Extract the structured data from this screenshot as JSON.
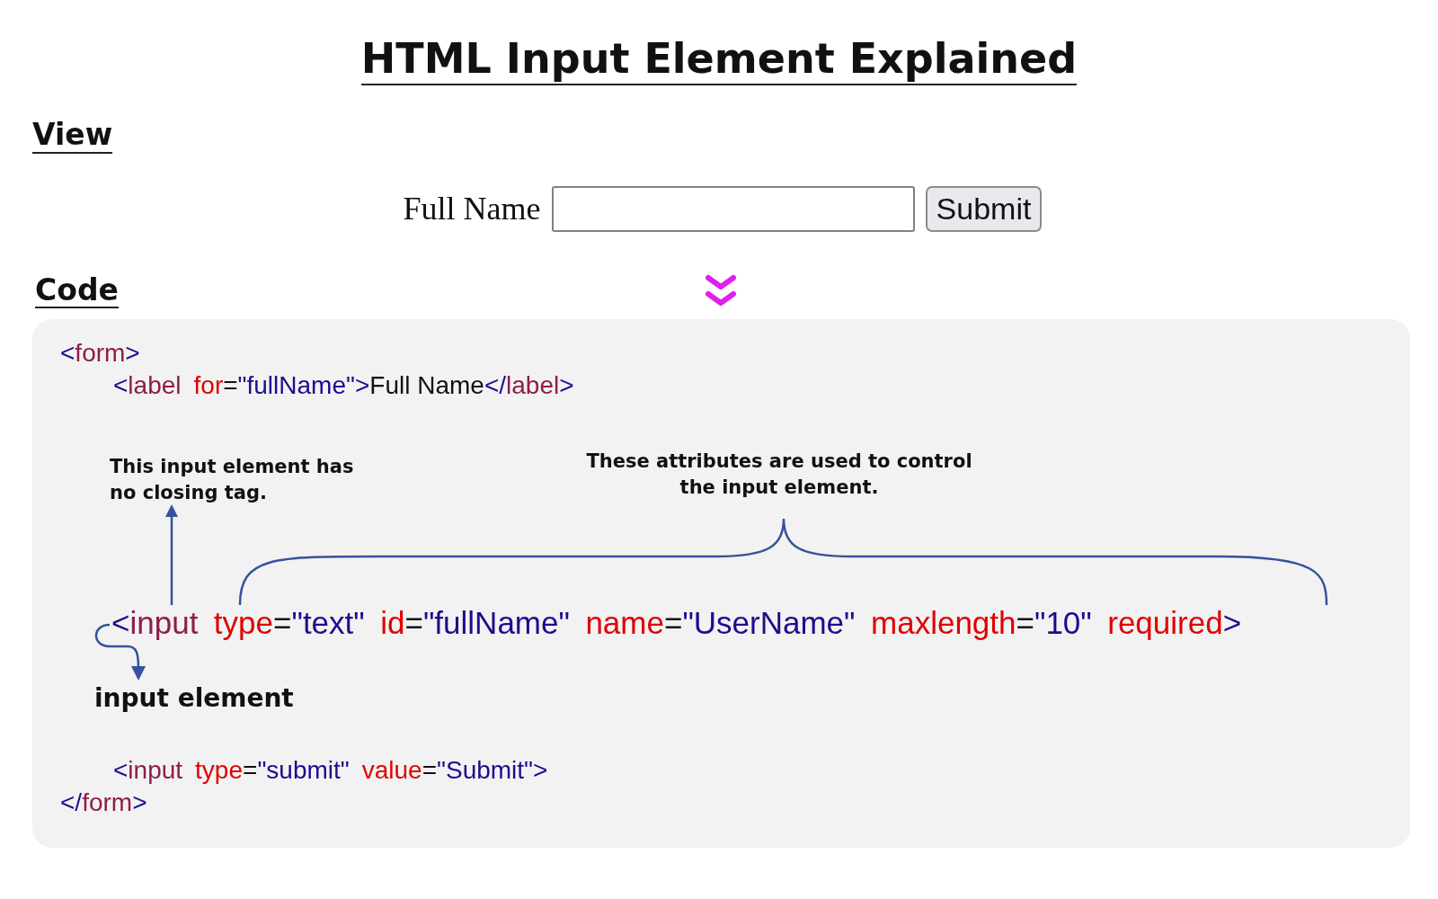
{
  "title": "HTML Input Element Explained",
  "view": {
    "heading": "View",
    "form": {
      "label": "Full Name",
      "button": "Submit"
    }
  },
  "code": {
    "heading": "Code",
    "open_tag": {
      "tokens": [
        {
          "kind": "punct",
          "text": "<"
        },
        {
          "kind": "tag",
          "text": "form"
        },
        {
          "kind": "punct",
          "text": ">"
        }
      ]
    },
    "children": [
      {
        "kind": "plain",
        "tokens": [
          {
            "kind": "punct",
            "text": "<"
          },
          {
            "kind": "tag",
            "text": "label"
          },
          {
            "kind": "attr",
            "text": "for"
          },
          {
            "kind": "eq",
            "text": "="
          },
          {
            "kind": "value",
            "text": "\"fullName\""
          },
          {
            "kind": "punct",
            "text": ">"
          },
          {
            "kind": "text",
            "text": "Full Name"
          },
          {
            "kind": "punct",
            "text": "</"
          },
          {
            "kind": "tag",
            "text": "label"
          },
          {
            "kind": "punct",
            "text": ">"
          }
        ]
      },
      {
        "kind": "annotated",
        "notes": {
          "closing": "This input element has\nno closing tag.",
          "attributes": "These attributes are used to control\nthe input element.",
          "element": "input element"
        },
        "tokens": [
          {
            "kind": "punct",
            "text": "<"
          },
          {
            "kind": "tag",
            "text": "input"
          },
          {
            "kind": "attr",
            "text": "type"
          },
          {
            "kind": "eq",
            "text": "="
          },
          {
            "kind": "value",
            "text": "\"text\""
          },
          {
            "kind": "attr",
            "text": "id"
          },
          {
            "kind": "eq",
            "text": "="
          },
          {
            "kind": "value",
            "text": "\"fullName\""
          },
          {
            "kind": "attr",
            "text": "name"
          },
          {
            "kind": "eq",
            "text": "="
          },
          {
            "kind": "value",
            "text": "\"UserName\""
          },
          {
            "kind": "attr",
            "text": "maxlength"
          },
          {
            "kind": "eq",
            "text": "="
          },
          {
            "kind": "value",
            "text": "\"10\""
          },
          {
            "kind": "attr",
            "text": "required"
          },
          {
            "kind": "punct",
            "text": ">"
          }
        ]
      },
      {
        "kind": "plain",
        "tokens": [
          {
            "kind": "punct",
            "text": "<"
          },
          {
            "kind": "tag",
            "text": "input"
          },
          {
            "kind": "attr",
            "text": "type"
          },
          {
            "kind": "eq",
            "text": "="
          },
          {
            "kind": "value",
            "text": "\"submit\""
          },
          {
            "kind": "attr",
            "text": "value"
          },
          {
            "kind": "eq",
            "text": "="
          },
          {
            "kind": "value",
            "text": "\"Submit\""
          },
          {
            "kind": "punct",
            "text": ">"
          }
        ]
      }
    ],
    "close_tag": {
      "tokens": [
        {
          "kind": "punct",
          "text": "</"
        },
        {
          "kind": "tag",
          "text": "form"
        },
        {
          "kind": "punct",
          "text": ">"
        }
      ]
    }
  }
}
